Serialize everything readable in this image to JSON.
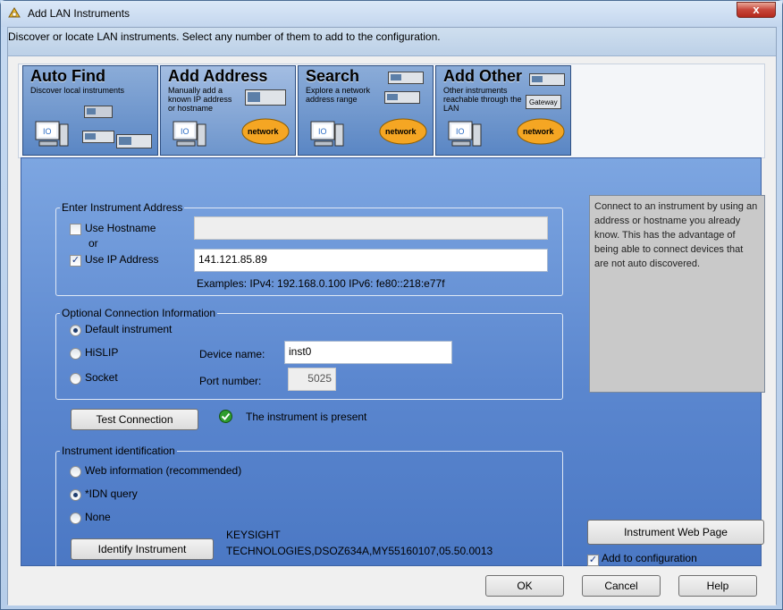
{
  "window": {
    "title": "Add LAN Instruments",
    "close_glyph": "x",
    "instruction": "Discover or locate LAN instruments. Select any number of them to add to the configuration."
  },
  "tabs": [
    {
      "title": "Auto Find",
      "subtitle": "Discover local instruments",
      "icon": "instrument-icon"
    },
    {
      "title": "Add Address",
      "subtitle": "Manually add a known IP address or hostname",
      "network": "network",
      "icon": "network-cloud-icon"
    },
    {
      "title": "Search",
      "subtitle": "Explore a network address range",
      "network": "network",
      "icon": "network-cloud-icon"
    },
    {
      "title": "Add Other",
      "subtitle": "Other instruments reachable through the LAN",
      "gateway": "Gateway",
      "network": "network",
      "icon": "gateway-icon"
    }
  ],
  "address_group": {
    "legend": "Enter Instrument Address",
    "use_hostname_label": "Use Hostname",
    "or_label": "or",
    "use_ip_label": "Use IP Address",
    "hostname_value": "",
    "ip_value": "141.121.85.89",
    "examples": "Examples: IPv4: 192.168.0.100   IPv6: fe80::218:e77f"
  },
  "connection_group": {
    "legend": "Optional Connection Information",
    "default_label": "Default instrument",
    "hislip_label": "HiSLIP",
    "socket_label": "Socket",
    "device_name_label": "Device name:",
    "device_name_value": "inst0",
    "port_label": "Port number:",
    "port_value": "5025"
  },
  "test": {
    "button_label": "Test Connection",
    "status_text": "The instrument is present",
    "status_color": "#2e9d2e"
  },
  "identification_group": {
    "legend": "Instrument identification",
    "web_label": "Web information (recommended)",
    "idn_label": "*IDN query",
    "none_label": "None",
    "identify_button": "Identify Instrument",
    "result_line1": "KEYSIGHT",
    "result_line2": "TECHNOLOGIES,DSOZ634A,MY55160107,05.50.0013"
  },
  "help_text": "Connect to an instrument by using an address or hostname you already know.  This has the advantage of being able to connect devices that are not auto discovered.",
  "web_page_button": "Instrument Web Page",
  "add_to_config_label": "Add to configuration",
  "footer": {
    "ok": "OK",
    "cancel": "Cancel",
    "help": "Help"
  },
  "colors": {
    "panel": "#5b87cf",
    "tab": "#6d95cc",
    "accent": "#1f3d6e"
  }
}
